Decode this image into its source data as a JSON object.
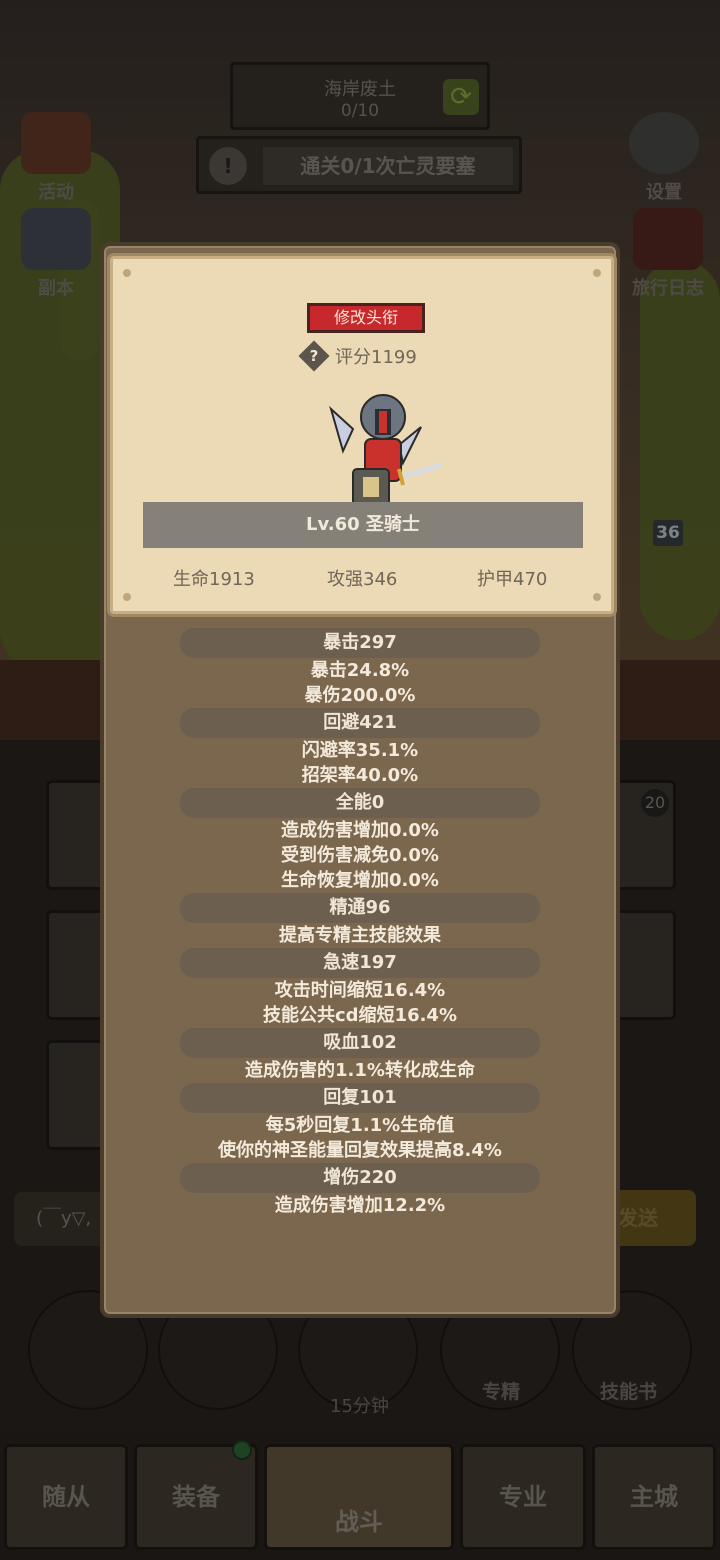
{
  "background": {
    "area": {
      "name": "海岸废土",
      "progress": "0/10"
    },
    "quest": {
      "text": "通关0/1次亡灵要塞"
    },
    "left_buttons": [
      {
        "label": "活动"
      },
      {
        "label": "副本"
      }
    ],
    "right_buttons": [
      {
        "label": "设置"
      },
      {
        "label": "旅行日志"
      }
    ],
    "level_tag": "36",
    "bag_count": "20",
    "chat_preview": "(￣y▽,",
    "send_label": "发送",
    "round_buttons": [
      {
        "label": "专精"
      },
      {
        "label": "技能书"
      }
    ],
    "timer": "15分钟",
    "tabs": [
      {
        "label": "随从"
      },
      {
        "label": "装备"
      },
      {
        "label": "战斗"
      },
      {
        "label": "专业"
      },
      {
        "label": "主城"
      }
    ]
  },
  "profile": {
    "title_button": "修改头衔",
    "help_icon": "?",
    "score": "评分1199",
    "name": "Lv.60 圣骑士",
    "hp": "生命1913",
    "attack": "攻强346",
    "armor": "护甲470"
  },
  "stats": [
    {
      "header": "暴击297",
      "lines": [
        "暴击24.8%",
        "暴伤200.0%"
      ]
    },
    {
      "header": "回避421",
      "lines": [
        "闪避率35.1%",
        "招架率40.0%"
      ]
    },
    {
      "header": "全能0",
      "lines": [
        "造成伤害增加0.0%",
        "受到伤害减免0.0%",
        "生命恢复增加0.0%"
      ]
    },
    {
      "header": "精通96",
      "lines": [
        "提高专精主技能效果"
      ]
    },
    {
      "header": "急速197",
      "lines": [
        "攻击时间缩短16.4%",
        "技能公共cd缩短16.4%"
      ]
    },
    {
      "header": "吸血102",
      "lines": [
        "造成伤害的1.1%转化成生命"
      ]
    },
    {
      "header": "回复101",
      "lines": [
        "每5秒回复1.1%生命值",
        "使你的神圣能量回复效果提高8.4%"
      ]
    },
    {
      "header": "增伤220",
      "lines": [
        "造成伤害增加12.2%"
      ]
    }
  ]
}
